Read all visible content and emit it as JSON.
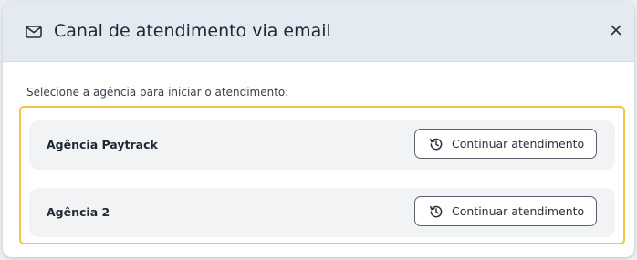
{
  "modal": {
    "title": "Canal de atendimento via email",
    "header_icon": "mail-icon",
    "close_icon": "close-icon",
    "close_glyph": "✕"
  },
  "instruction": "Selecione a agência para iniciar o atendimento:",
  "agencies": [
    {
      "name": "Agência Paytrack",
      "button_label": "Continuar atendimento",
      "button_icon": "history-icon"
    },
    {
      "name": "Agência 2",
      "button_label": "Continuar atendimento",
      "button_icon": "history-icon"
    }
  ],
  "colors": {
    "header_bg": "#e3eaf2",
    "highlight_border": "#f5c443",
    "row_bg": "#f2f3f5",
    "text_primary": "#1f2733"
  }
}
